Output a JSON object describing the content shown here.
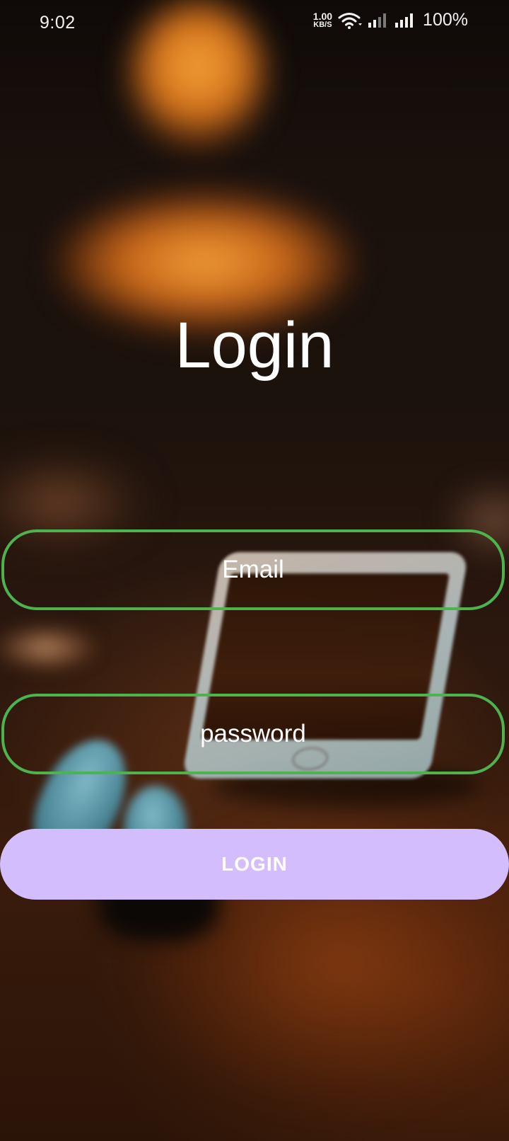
{
  "status_bar": {
    "time": "9:02",
    "net_speed_value": "1.00",
    "net_speed_unit": "KB/S",
    "battery": "100%",
    "icons": [
      "wifi-icon",
      "signal-icon",
      "signal-icon"
    ]
  },
  "login": {
    "title": "Login",
    "email": {
      "placeholder": "Email",
      "value": ""
    },
    "password": {
      "placeholder": "password",
      "value": ""
    },
    "button_label": "LOGIN"
  },
  "colors": {
    "field_border": "#4cb34f",
    "button_bg": "#d3bdfc",
    "text": "#ffffff"
  }
}
